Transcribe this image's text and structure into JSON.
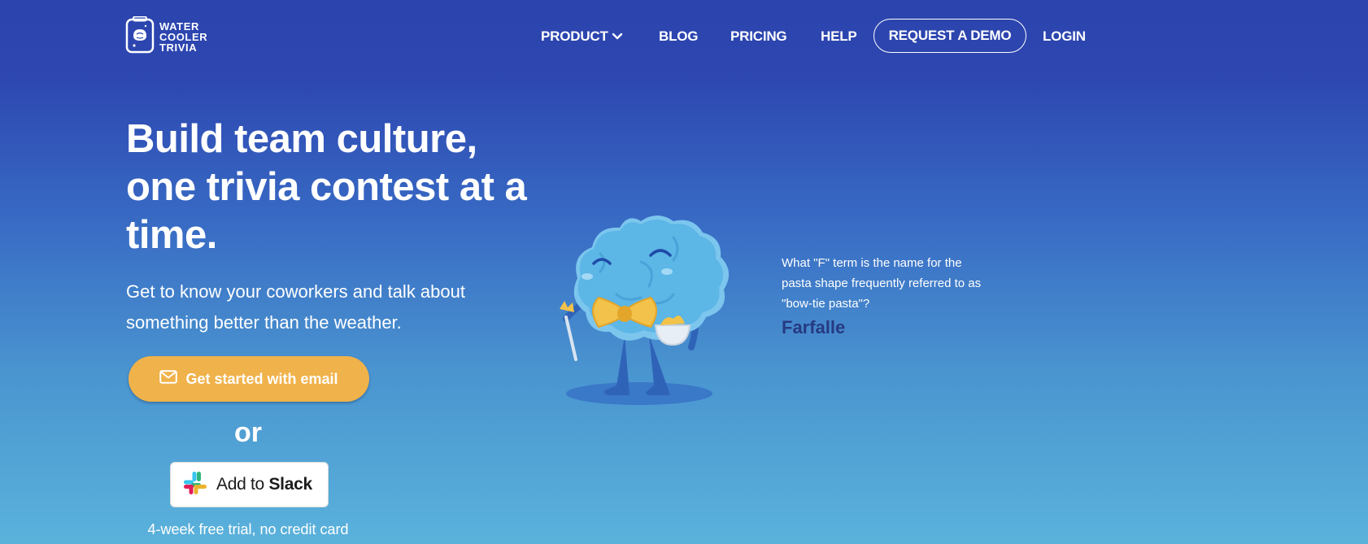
{
  "brand": {
    "logo_lines": [
      "WATER",
      "COOLER",
      "TRIVIA"
    ],
    "logo_icon": "water-cooler-brain-icon"
  },
  "nav": {
    "product": "PRODUCT",
    "product_icon": "chevron-down-icon",
    "blog": "BLOG",
    "pricing": "PRICING",
    "help": "HELP",
    "request_demo": "REQUEST A DEMO",
    "login": "LOGIN"
  },
  "hero": {
    "headline": "Build team culture, one trivia contest at a time.",
    "subheadline": "Get to know your coworkers and talk about something better than the weather.",
    "email_cta": "Get started with email",
    "email_icon": "envelope-icon",
    "or_text": "or",
    "slack_cta_prefix": "Add to",
    "slack_cta_brand": "Slack",
    "slack_icon": "slack-logo-icon",
    "trial_note": "4-week free trial, no credit card"
  },
  "trivia": {
    "question": "What \"F\" term is the name for the pasta shape frequently referred to as \"bow-tie pasta\"?",
    "answer": "Farfalle",
    "mascot": "brain-mascot-with-bowtie"
  },
  "colors": {
    "background_top": "#2c44ae",
    "background_bottom": "#5ab2db",
    "cta_orange": "#f0b24a",
    "answer_navy": "#263a82"
  }
}
